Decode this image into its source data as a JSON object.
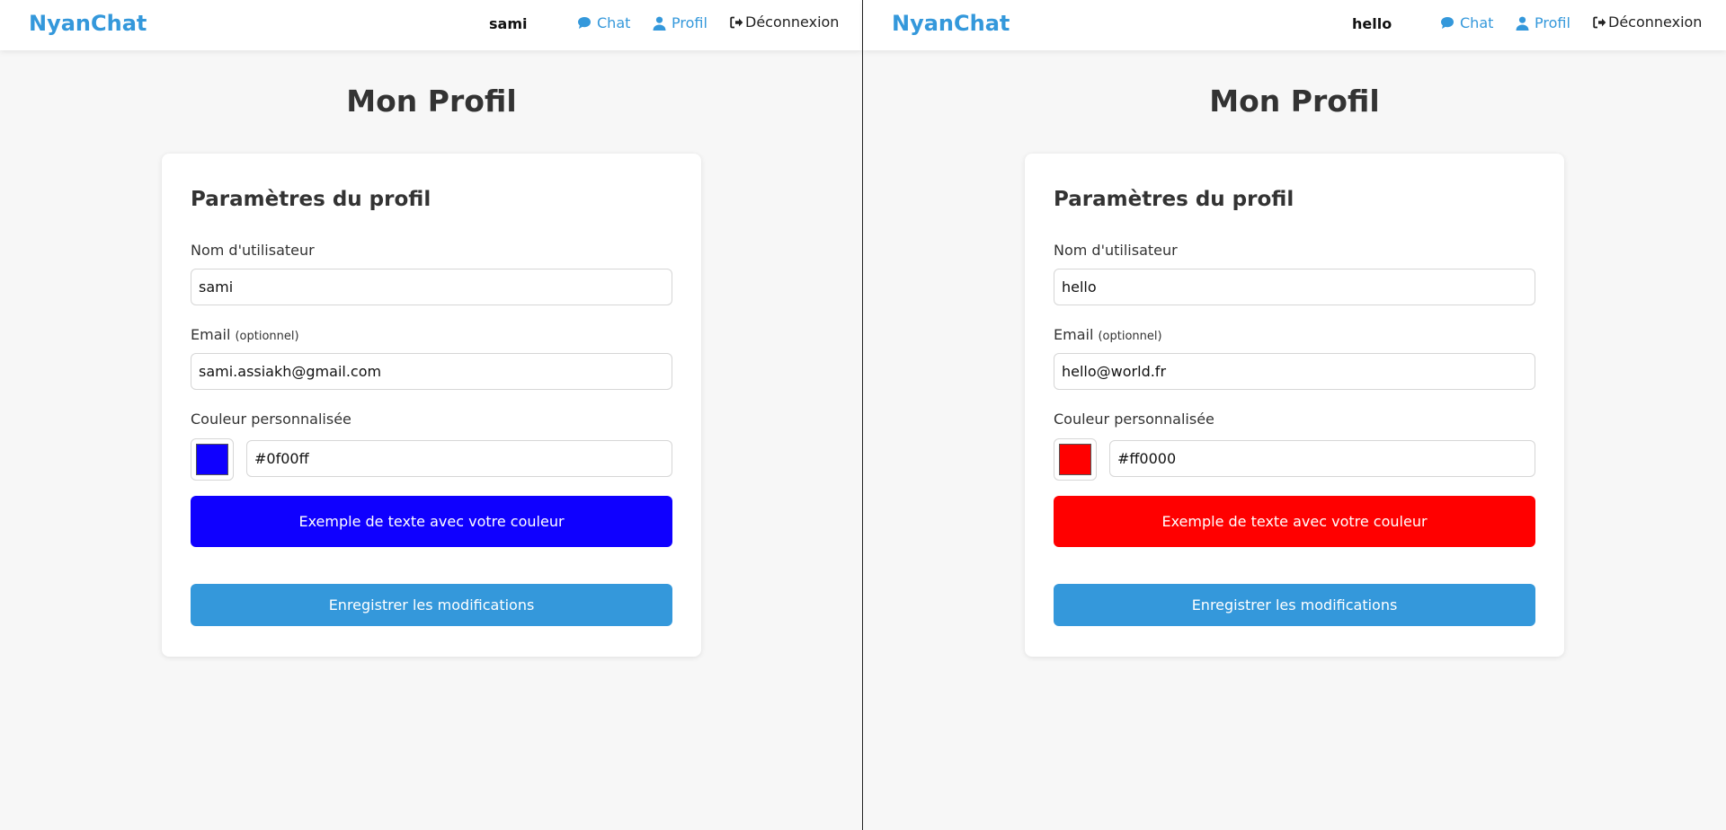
{
  "panes": [
    {
      "brand": "NyanChat",
      "user": "sami",
      "nav": {
        "chat": "Chat",
        "profil": "Profil",
        "logout": "Déconnexion"
      },
      "page_title": "Mon Profil",
      "card": {
        "title": "Paramètres du profil",
        "username_label": "Nom d'utilisateur",
        "username_value": "sami",
        "email_label": "Email",
        "email_hint": "(optionnel)",
        "email_value": "sami.assiakh@gmail.com",
        "color_label": "Couleur personnalisée",
        "color_value": "#0f00ff",
        "preview_text": "Exemple de texte avec votre couleur",
        "save_label": "Enregistrer les modifications"
      }
    },
    {
      "brand": "NyanChat",
      "user": "hello",
      "nav": {
        "chat": "Chat",
        "profil": "Profil",
        "logout": "Déconnexion"
      },
      "page_title": "Mon Profil",
      "card": {
        "title": "Paramètres du profil",
        "username_label": "Nom d'utilisateur",
        "username_value": "hello",
        "email_label": "Email",
        "email_hint": "(optionnel)",
        "email_value": "hello@world.fr",
        "color_label": "Couleur personnalisée",
        "color_value": "#ff0000",
        "preview_text": "Exemple de texte avec votre couleur",
        "save_label": "Enregistrer les modifications"
      }
    }
  ],
  "colors": {
    "accent": "#3498db",
    "background": "#f7f7f7"
  },
  "icons": {
    "chat": "chat-bubble-icon",
    "profil": "user-icon",
    "logout": "sign-out-icon"
  }
}
